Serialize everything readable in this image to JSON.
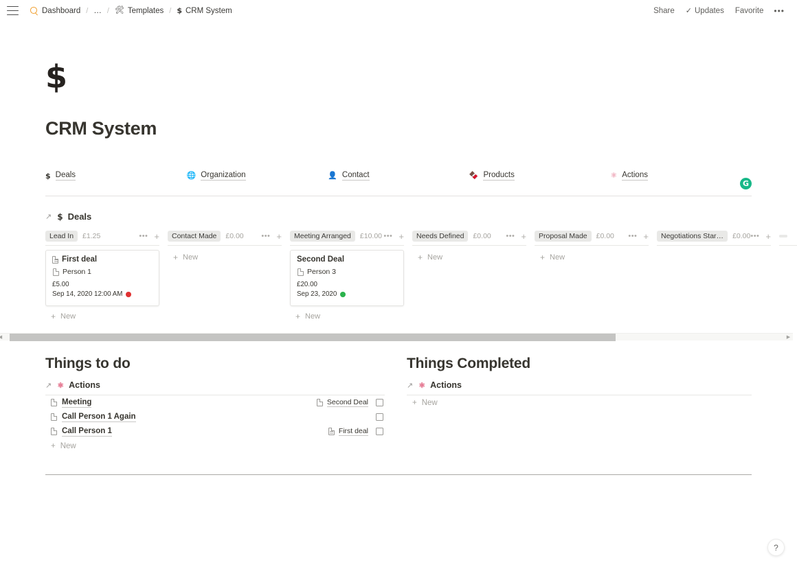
{
  "topbar": {
    "menu_icon": "hamburger-icon",
    "breadcrumbs": [
      {
        "icon": "search-icon",
        "label": "Dashboard"
      },
      {
        "icon": "",
        "label": "…"
      },
      {
        "icon": "🛠",
        "label": "Templates"
      },
      {
        "icon": "$",
        "label": "CRM System"
      }
    ],
    "separator": "/",
    "right": {
      "share": "Share",
      "updates": "Updates",
      "updates_icon": "✓",
      "favorite": "Favorite",
      "more": "•••"
    }
  },
  "page": {
    "icon": "$",
    "title": "CRM System",
    "avatar_initial": "G",
    "avatar_color": "#18b888"
  },
  "links": [
    {
      "icon": "$",
      "label": "Deals"
    },
    {
      "icon": "🌐",
      "label": "Organization"
    },
    {
      "icon": "👤",
      "label": "Contact"
    },
    {
      "icon": "🍫",
      "label": "Products"
    },
    {
      "icon": "⚛",
      "label": "Actions"
    }
  ],
  "deals_db": {
    "arrow": "↗",
    "icon": "$",
    "title": "Deals",
    "new_label": "New",
    "dots": "•••",
    "plus": "+",
    "columns": [
      {
        "tag": "Lead In",
        "sum": "£1.25",
        "cards": [
          {
            "title": "First deal",
            "title_icon": "page-lined-icon",
            "relation": "Person 1",
            "amount": "£5.00",
            "date": "Sep 14, 2020 12:00 AM",
            "status_color": "#e03131"
          }
        ]
      },
      {
        "tag": "Contact Made",
        "sum": "£0.00",
        "cards": []
      },
      {
        "tag": "Meeting Arranged",
        "sum": "£10.00",
        "cards": [
          {
            "title": "Second Deal",
            "title_icon": "",
            "relation": "Person 3",
            "amount": "£20.00",
            "date": "Sep 23, 2020",
            "status_color": "#2bb24c"
          }
        ]
      },
      {
        "tag": "Needs Defined",
        "sum": "£0.00",
        "cards": []
      },
      {
        "tag": "Proposal Made",
        "sum": "£0.00",
        "cards": []
      },
      {
        "tag": "Negotiations Started",
        "sum": "£0.00",
        "cards": []
      },
      {
        "tag": "",
        "sum": "",
        "cards": []
      }
    ]
  },
  "scrollbar": {
    "left_arrow": "◀",
    "right_arrow": "▶"
  },
  "sections": [
    {
      "heading": "Things to do",
      "db": {
        "arrow": "↗",
        "icon": "⚛",
        "title": "Actions"
      },
      "rows": [
        {
          "name": "Meeting",
          "relation": "Second Deal",
          "relation_icon": "page-icon",
          "checked": false
        },
        {
          "name": "Call Person 1 Again",
          "relation": "",
          "relation_icon": "",
          "checked": false
        },
        {
          "name": "Call Person 1",
          "relation": "First deal",
          "relation_icon": "page-lined-icon",
          "checked": false
        }
      ],
      "new_label": "New"
    },
    {
      "heading": "Things Completed",
      "db": {
        "arrow": "↗",
        "icon": "⚛",
        "title": "Actions"
      },
      "rows": [],
      "new_label": "New"
    }
  ],
  "help_button": "?"
}
